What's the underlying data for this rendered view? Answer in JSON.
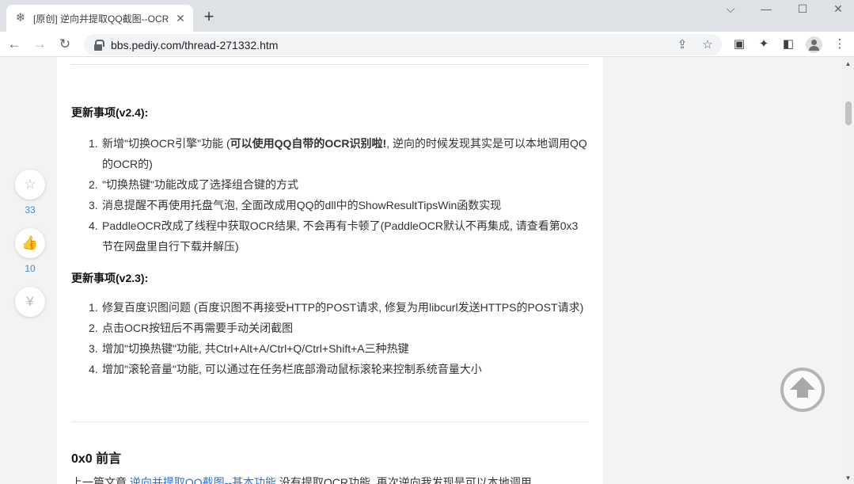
{
  "browser": {
    "tab_title": "[原创] 逆向并提取QQ截图--OCR",
    "tab_icon": "snowflake-icon",
    "url": "bbs.pediy.com/thread-271332.htm"
  },
  "article": {
    "section_v24": {
      "heading": "更新事项(v2.4):",
      "items": [
        {
          "num": "1.",
          "pre": "新增\"切换OCR引擎\"功能 (",
          "bold": "可以使用QQ自带的OCR识别啦!",
          "post": ", 逆向的时候发现其实是可以本地调用QQ的OCR的)"
        },
        {
          "num": "2.",
          "text": "\"切换热键\"功能改成了选择组合键的方式"
        },
        {
          "num": "3.",
          "text": "消息提醒不再使用托盘气泡, 全面改成用QQ的dll中的ShowResultTipsWin函数实现"
        },
        {
          "num": "4.",
          "text": "PaddleOCR改成了线程中获取OCR结果, 不会再有卡顿了(PaddleOCR默认不再集成, 请查看第0x3节在网盘里自行下载并解压)"
        }
      ]
    },
    "section_v23": {
      "heading": "更新事项(v2.3):",
      "items": [
        {
          "num": "1.",
          "text": "修复百度识图问题 (百度识图不再接受HTTP的POST请求, 修复为用libcurl发送HTTPS的POST请求)"
        },
        {
          "num": "2.",
          "text": "点击OCR按钮后不再需要手动关闭截图"
        },
        {
          "num": "3.",
          "text": "增加\"切换热键\"功能, 共Ctrl+Alt+A/Ctrl+Q/Ctrl+Shift+A三种热键"
        },
        {
          "num": "4.",
          "text": "增加\"滚轮音量\"功能, 可以通过在任务栏底部滑动鼠标滚轮来控制系统音量大小"
        }
      ]
    },
    "preface_heading": "0x0 前言",
    "preface": {
      "pre": "上一篇文章 ",
      "link": "逆向并提取QQ截图--基本功能",
      "post": " 没有提取OCR功能, 再次逆向我发现是可以本地调用"
    }
  },
  "side_actions": {
    "favorite_count": "33",
    "like_count": "10",
    "tip_symbol": "¥"
  }
}
